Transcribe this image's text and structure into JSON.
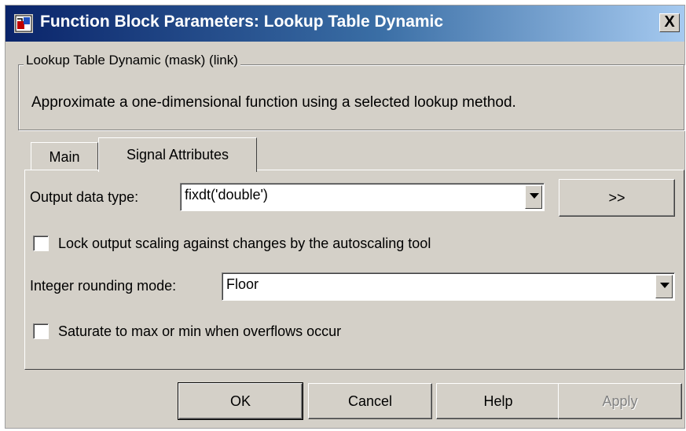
{
  "window": {
    "title": "Function Block Parameters: Lookup Table Dynamic",
    "close_label": "X"
  },
  "group": {
    "legend": "Lookup Table Dynamic (mask) (link)",
    "description": "Approximate a one-dimensional function using a selected lookup method."
  },
  "tabs": [
    {
      "label": "Main",
      "selected": false
    },
    {
      "label": "Signal Attributes",
      "selected": true
    }
  ],
  "signal_attributes": {
    "output_data_type_label": "Output data type:",
    "output_data_type_value": "fixdt('double')",
    "data_type_assistant_label": ">>",
    "lock_scaling_label": "Lock output scaling against changes by the autoscaling tool",
    "lock_scaling_checked": false,
    "rounding_mode_label": "Integer rounding mode:",
    "rounding_mode_value": "Floor",
    "saturate_label": "Saturate to max or min when overflows occur",
    "saturate_checked": false
  },
  "buttons": {
    "ok": "OK",
    "cancel": "Cancel",
    "help": "Help",
    "apply": "Apply"
  },
  "colors": {
    "dialog_bg": "#d4d0c8",
    "titlebar_start": "#0a246a",
    "titlebar_end": "#a6caf0",
    "disabled_text": "#808080"
  }
}
